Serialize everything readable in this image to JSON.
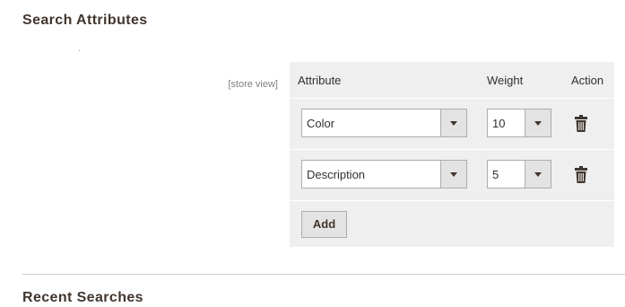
{
  "sections": {
    "search_attributes_title": "Search Attributes",
    "recent_searches_title": "Recent Searches"
  },
  "scope_label": "[store view]",
  "grid": {
    "headers": {
      "attribute": "Attribute",
      "weight": "Weight",
      "action": "Action"
    },
    "rows": [
      {
        "attribute": "Color",
        "weight": "10"
      },
      {
        "attribute": "Description",
        "weight": "5"
      }
    ],
    "add_label": "Add"
  },
  "icons": {
    "delete": "trash-icon",
    "dropdown": "chevron-down-icon"
  }
}
